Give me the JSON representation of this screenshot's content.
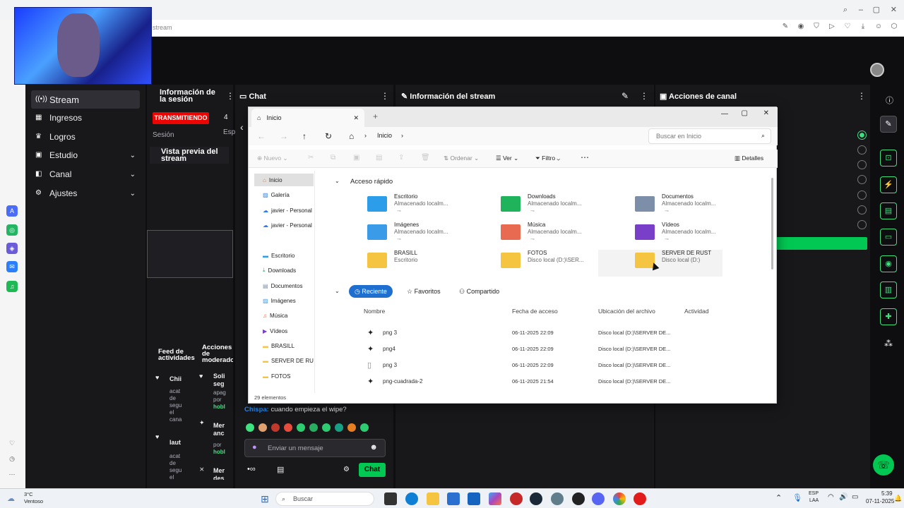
{
  "browser": {
    "url": "stream"
  },
  "nav": {
    "items": [
      {
        "label": "Stream",
        "icon": "broadcast-icon",
        "active": true
      },
      {
        "label": "Ingresos",
        "icon": "revenue-icon"
      },
      {
        "label": "Logros",
        "icon": "trophy-icon"
      },
      {
        "label": "Estudio",
        "icon": "studio-icon",
        "expand": true
      },
      {
        "label": "Canal",
        "icon": "channel-icon",
        "expand": true
      },
      {
        "label": "Ajustes",
        "icon": "gear-icon",
        "expand": true
      }
    ]
  },
  "session": {
    "title": "Información de la sesión",
    "live_badge": "TRANSMITIENDO",
    "count": "4",
    "session_label": "Sesión",
    "esp_label": "Esp",
    "preview_title": "Vista previa del stream"
  },
  "chat": {
    "title": "Chat",
    "last_user": "Chispa:",
    "last_message": "cuando empieza el wipe?",
    "placeholder": "Enviar un mensaje",
    "send_label": "Chat"
  },
  "stream_info": {
    "title": "Información del stream"
  },
  "channel_actions": {
    "title": "Acciones de canal"
  },
  "feed": {
    "title": "Feed de actividades",
    "items": [
      {
        "name": "Chii",
        "lines": [
          "acat",
          "de",
          "segu",
          "el",
          "cana"
        ]
      },
      {
        "name": "laut",
        "lines": [
          "acat",
          "de",
          "segu",
          "el"
        ]
      }
    ]
  },
  "mod": {
    "title": "Acciones de moderador",
    "items": [
      {
        "name": "Soli",
        "sub": "seg",
        "lines": [
          "apag",
          "por"
        ],
        "user": "hobl"
      },
      {
        "name": "Mer",
        "sub": "anc",
        "lines": [
          "por"
        ],
        "user": "hobl"
      },
      {
        "name": "Mer",
        "sub": "des",
        "lines": [],
        "user": ""
      }
    ]
  },
  "explorer": {
    "tab_title": "Inicio",
    "breadcrumb": "Inicio",
    "search_placeholder": "Buscar en Inicio",
    "toolbar": {
      "new": "Nuevo",
      "sort": "Ordenar",
      "view": "Ver",
      "filter": "Filtro",
      "details": "Detalles"
    },
    "sidebar": [
      {
        "label": "Inicio",
        "icon": "home-icon",
        "selected": true
      },
      {
        "label": "Galería",
        "icon": "gallery-icon"
      },
      {
        "label": "javier - Personal",
        "icon": "cloud-icon"
      },
      {
        "label": "javier - Personal",
        "icon": "cloud-icon"
      },
      {
        "label": "Escritorio",
        "icon": "desktop-icon"
      },
      {
        "label": "Downloads",
        "icon": "download-icon"
      },
      {
        "label": "Documentos",
        "icon": "documents-icon"
      },
      {
        "label": "Imágenes",
        "icon": "images-icon"
      },
      {
        "label": "Música",
        "icon": "music-icon"
      },
      {
        "label": "Vídeos",
        "icon": "videos-icon"
      },
      {
        "label": "BRASILL",
        "icon": "folder-icon"
      },
      {
        "label": "SERVER DE RUST",
        "icon": "folder-icon"
      },
      {
        "label": "FOTOS",
        "icon": "folder-icon"
      }
    ],
    "status": "29 elementos",
    "quick_access_title": "Acceso rápido",
    "quick_access": [
      {
        "name": "Escritorio",
        "loc": "Almacenado localm...",
        "pin": "⊸",
        "color": "#2b9de9"
      },
      {
        "name": "Downloads",
        "loc": "Almacenado localm...",
        "pin": "⊸",
        "color": "#1fb35b"
      },
      {
        "name": "Documentos",
        "loc": "Almacenado localm...",
        "pin": "⊸",
        "color": "#7d8fa8"
      },
      {
        "name": "Imágenes",
        "loc": "Almacenado localm...",
        "pin": "⊸",
        "color": "#3a9be8"
      },
      {
        "name": "Música",
        "loc": "Almacenado localm...",
        "pin": "⊸",
        "color": "#e86a50"
      },
      {
        "name": "Vídeos",
        "loc": "Almacenado localm...",
        "pin": "⊸",
        "color": "#7a3fc8"
      },
      {
        "name": "BRASILL",
        "loc": "Escritorio",
        "pin": "",
        "color": "#f5c542"
      },
      {
        "name": "FOTOS",
        "loc": "Disco local (D:)\\SER...",
        "pin": "",
        "color": "#f5c542"
      },
      {
        "name": "SERVER DE RUST",
        "loc": "Disco local (D:)",
        "pin": "",
        "color": "#f5c542"
      }
    ],
    "filters": {
      "recent": "Reciente",
      "favorites": "Favoritos",
      "shared": "Compartido"
    },
    "columns": {
      "name": "Nombre",
      "date": "Fecha de acceso",
      "location": "Ubicación del archivo",
      "activity": "Actividad"
    },
    "rows": [
      {
        "name": "png 3",
        "date": "06-11-2025 22:09",
        "location": "Disco local (D:)\\SERVER DE..."
      },
      {
        "name": "png4",
        "date": "06-11-2025 22:09",
        "location": "Disco local (D:)\\SERVER DE..."
      },
      {
        "name": "png 3",
        "date": "06-11-2025 22:09",
        "location": "Disco local (D:)\\SERVER DE..."
      },
      {
        "name": "png-cuadrada-2",
        "date": "06-11-2025 21:54",
        "location": "Disco local (D:)\\SERVER DE..."
      }
    ]
  },
  "taskbar": {
    "weather_temp": "3°C",
    "weather_desc": "Ventoso",
    "search": "Buscar",
    "lang_top": "ESP",
    "lang_bottom": "LAA",
    "time": "5:39",
    "date": "07-11-2025"
  },
  "colors": {
    "accent_green": "#00c853",
    "live_red": "#eb0400",
    "chat_user": "#1e90ff"
  }
}
